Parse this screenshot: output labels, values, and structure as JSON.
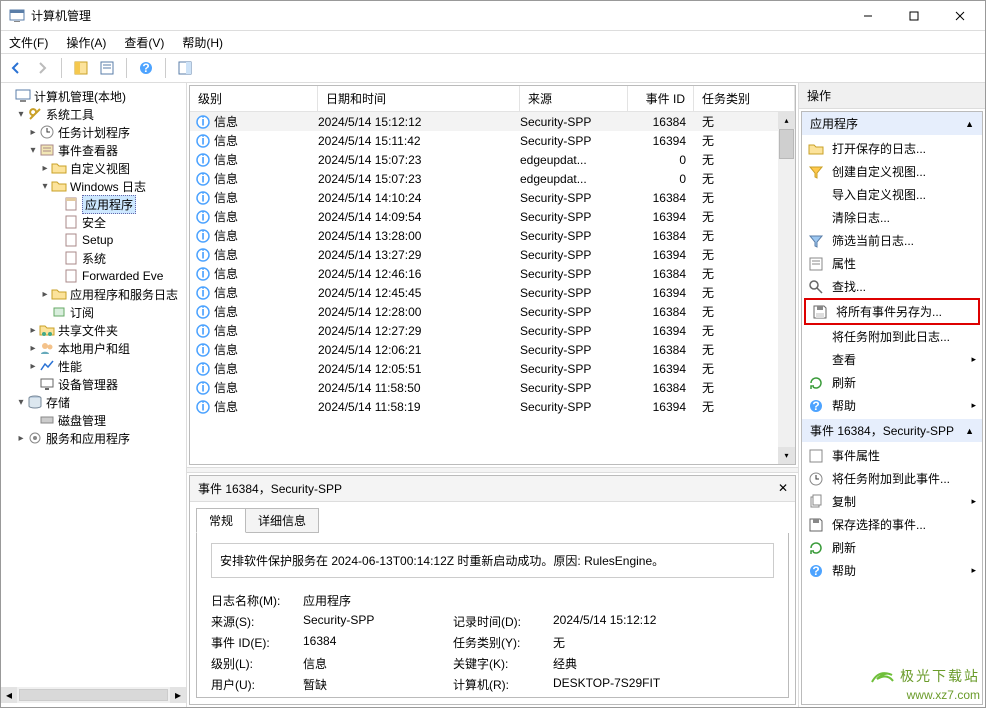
{
  "window": {
    "title": "计算机管理"
  },
  "menu": {
    "file": "文件(F)",
    "action": "操作(A)",
    "view": "查看(V)",
    "help": "帮助(H)"
  },
  "tree": {
    "root": "计算机管理(本地)",
    "sys": "系统工具",
    "task": "任务计划程序",
    "evt": "事件查看器",
    "cust": "自定义视图",
    "winlog": "Windows 日志",
    "app": "应用程序",
    "sec": "安全",
    "setup": "Setup",
    "system": "系统",
    "fwd": "Forwarded Eve",
    "appsvc": "应用程序和服务日志",
    "sub": "订阅",
    "shared": "共享文件夹",
    "local": "本地用户和组",
    "perf": "性能",
    "dev": "设备管理器",
    "storage": "存储",
    "disk": "磁盘管理",
    "svcapp": "服务和应用程序"
  },
  "columns": {
    "level": "级别",
    "datetime": "日期和时间",
    "source": "来源",
    "eventid": "事件 ID",
    "category": "任务类别"
  },
  "info_label": "信息",
  "events": [
    {
      "dt": "2024/5/14 15:12:12",
      "src": "Security-SPP",
      "id": "16384",
      "cat": "无"
    },
    {
      "dt": "2024/5/14 15:11:42",
      "src": "Security-SPP",
      "id": "16394",
      "cat": "无"
    },
    {
      "dt": "2024/5/14 15:07:23",
      "src": "edgeupdat...",
      "id": "0",
      "cat": "无"
    },
    {
      "dt": "2024/5/14 15:07:23",
      "src": "edgeupdat...",
      "id": "0",
      "cat": "无"
    },
    {
      "dt": "2024/5/14 14:10:24",
      "src": "Security-SPP",
      "id": "16384",
      "cat": "无"
    },
    {
      "dt": "2024/5/14 14:09:54",
      "src": "Security-SPP",
      "id": "16394",
      "cat": "无"
    },
    {
      "dt": "2024/5/14 13:28:00",
      "src": "Security-SPP",
      "id": "16384",
      "cat": "无"
    },
    {
      "dt": "2024/5/14 13:27:29",
      "src": "Security-SPP",
      "id": "16394",
      "cat": "无"
    },
    {
      "dt": "2024/5/14 12:46:16",
      "src": "Security-SPP",
      "id": "16384",
      "cat": "无"
    },
    {
      "dt": "2024/5/14 12:45:45",
      "src": "Security-SPP",
      "id": "16394",
      "cat": "无"
    },
    {
      "dt": "2024/5/14 12:28:00",
      "src": "Security-SPP",
      "id": "16384",
      "cat": "无"
    },
    {
      "dt": "2024/5/14 12:27:29",
      "src": "Security-SPP",
      "id": "16394",
      "cat": "无"
    },
    {
      "dt": "2024/5/14 12:06:21",
      "src": "Security-SPP",
      "id": "16384",
      "cat": "无"
    },
    {
      "dt": "2024/5/14 12:05:51",
      "src": "Security-SPP",
      "id": "16394",
      "cat": "无"
    },
    {
      "dt": "2024/5/14 11:58:50",
      "src": "Security-SPP",
      "id": "16384",
      "cat": "无"
    },
    {
      "dt": "2024/5/14 11:58:19",
      "src": "Security-SPP",
      "id": "16394",
      "cat": "无"
    }
  ],
  "detail": {
    "title": "事件 16384，Security-SPP",
    "tab_general": "常规",
    "tab_details": "详细信息",
    "message": "安排软件保护服务在 2024-06-13T00:14:12Z 时重新启动成功。原因: RulesEngine。",
    "l_logname": "日志名称(M):",
    "v_logname": "应用程序",
    "l_source": "来源(S):",
    "v_source": "Security-SPP",
    "l_logged": "记录时间(D):",
    "v_logged": "2024/5/14 15:12:12",
    "l_eventid": "事件 ID(E):",
    "v_eventid": "16384",
    "l_taskcat": "任务类别(Y):",
    "v_taskcat": "无",
    "l_level": "级别(L):",
    "v_level": "信息",
    "l_keywords": "关键字(K):",
    "v_keywords": "经典",
    "l_user": "用户(U):",
    "v_user": "暂缺",
    "l_computer": "计算机(R):",
    "v_computer": "DESKTOP-7S29FIT"
  },
  "actions": {
    "header": "操作",
    "grp1": "应用程序",
    "open": "打开保存的日志...",
    "createview": "创建自定义视图...",
    "importview": "导入自定义视图...",
    "clear": "清除日志...",
    "filter": "筛选当前日志...",
    "props": "属性",
    "find": "查找...",
    "saveall": "将所有事件另存为...",
    "attach": "将任务附加到此日志...",
    "view": "查看",
    "refresh": "刷新",
    "help": "帮助",
    "grp2": "事件 16384，Security-SPP",
    "evtprops": "事件属性",
    "attach2": "将任务附加到此事件...",
    "copy": "复制",
    "savesel": "保存选择的事件...",
    "refresh2": "刷新",
    "help2": "帮助"
  },
  "watermark": {
    "l1": "极光下载站",
    "l2": "www.xz7.com"
  }
}
